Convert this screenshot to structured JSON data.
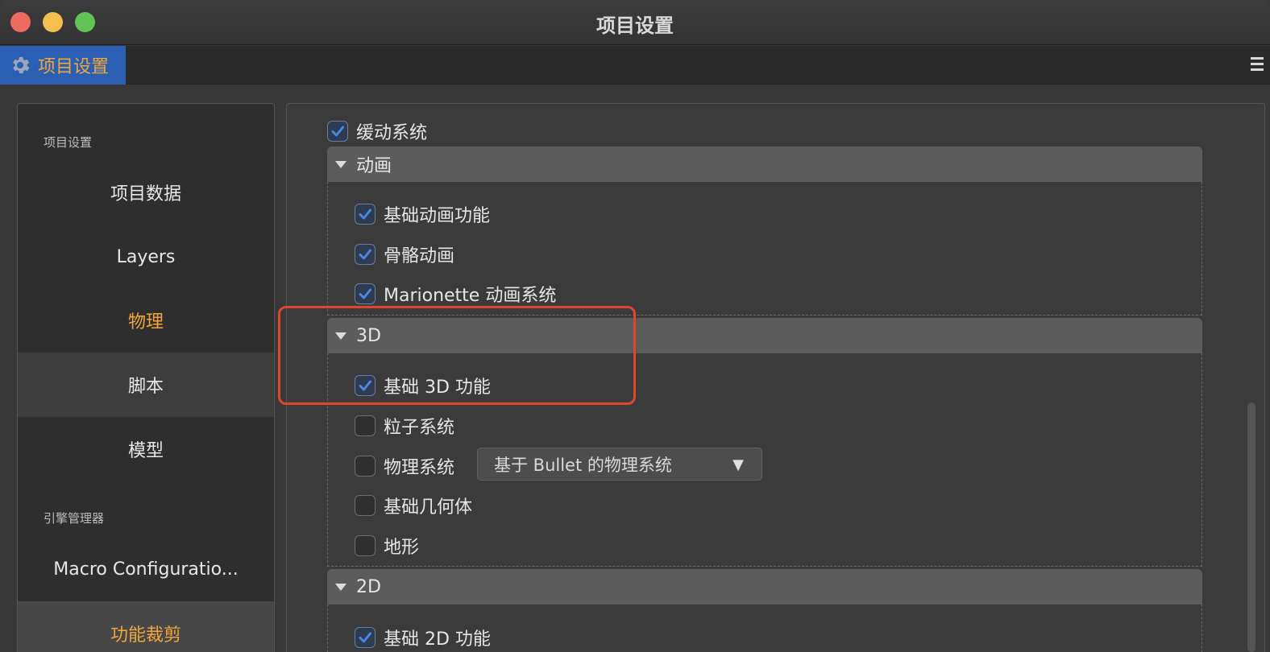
{
  "window": {
    "title": "项目设置"
  },
  "tab": {
    "label": "项目设置",
    "icon": "gear-icon"
  },
  "sidebar": {
    "section1": "项目设置",
    "items1": [
      {
        "label": "项目数据"
      },
      {
        "label": "Layers"
      },
      {
        "label": "物理"
      },
      {
        "label": "脚本"
      },
      {
        "label": "模型"
      }
    ],
    "section2": "引擎管理器",
    "items2": [
      {
        "label": "Macro Configuratio..."
      },
      {
        "label": "功能裁剪"
      }
    ]
  },
  "main": {
    "top_option": {
      "label": "缓动系统",
      "checked": true
    },
    "groups": {
      "animation": {
        "title": "动画",
        "options": [
          {
            "label": "基础动画功能",
            "checked": true
          },
          {
            "label": "骨骼动画",
            "checked": true
          },
          {
            "label": "Marionette 动画系统",
            "checked": true
          }
        ]
      },
      "threed": {
        "title": "3D",
        "options": [
          {
            "label": "基础 3D 功能",
            "checked": true
          },
          {
            "label": "粒子系统",
            "checked": false
          },
          {
            "label": "物理系统",
            "checked": false
          },
          {
            "label": "基础几何体",
            "checked": false
          },
          {
            "label": "地形",
            "checked": false
          }
        ],
        "physics_select": {
          "value": "基于 Bullet 的物理系统"
        }
      },
      "twod": {
        "title": "2D",
        "options": [
          {
            "label": "基础 2D 功能",
            "checked": true
          }
        ]
      }
    }
  },
  "colors": {
    "accent": "#f0a63a",
    "tab_bg": "#2b5fb4",
    "annotation": "#e0452f",
    "check": "#4a86e8"
  }
}
